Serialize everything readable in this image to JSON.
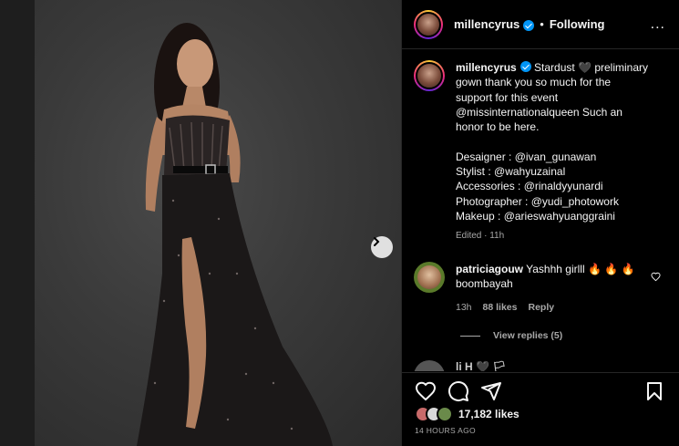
{
  "post": {
    "username": "millencyrus",
    "follow_status": "Following",
    "separator": "•",
    "more_icon": "..."
  },
  "caption": {
    "username": "millencyrus",
    "lines": [
      " Stardust 🖤 preliminary",
      "gown thank you so much for the",
      "support for this event",
      "@missinternationalqueen Such an",
      "honor to be here.",
      "",
      "Desaigner : @ivan_gunawan",
      "Stylist : @wahyuzainal",
      "Accessories : @rinaldyyunardi",
      "Photographer : @yudi_photowork",
      "Makeup : @arieswahyuanggraini"
    ],
    "edited": "Edited · 11h"
  },
  "comment": {
    "username": "patriciagouw",
    "text_line1": " Yashhh girlll 🔥 🔥 🔥",
    "text_line2": "boombayah",
    "time": "13h",
    "likes": "88 likes",
    "reply": "Reply",
    "view_replies": "View replies (5)"
  },
  "partial_comment": {
    "text": "li    H     🖤 🏳"
  },
  "footer": {
    "likes": "17,182 likes",
    "timestamp": "14 HOURS AGO"
  },
  "icons": [
    "heart-icon",
    "comment-icon",
    "share-icon",
    "bookmark-icon",
    "chevron-right-icon",
    "verified-icon",
    "more-options-icon"
  ],
  "colors": {
    "verified": "#0095f6",
    "secondary_text": "#a8a8a8",
    "divider": "#262626"
  }
}
